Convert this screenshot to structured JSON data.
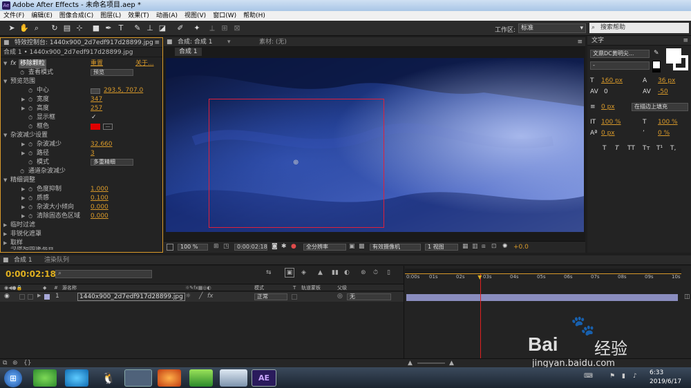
{
  "window": {
    "title": "Adobe After Effects - 未命名项目.aep *",
    "logo": "Ae"
  },
  "menu": [
    "文件(F)",
    "编辑(E)",
    "图像合成(C)",
    "图层(L)",
    "效果(T)",
    "动画(A)",
    "视图(V)",
    "窗口(W)",
    "帮助(H)"
  ],
  "toolbar": {
    "workspace_label": "工作区:",
    "workspace_value": "标准",
    "search_placeholder": "搜索帮助"
  },
  "effects_panel": {
    "tab": "特效控制台: 1440x900_2d7edf917d28899.jpg",
    "header": "合成 1 • 1440x900_2d7edf917d28899.jpg",
    "effect_name": "移除颗粒",
    "reset": "重置",
    "about": "关于...",
    "view_mode_label": "查看模式",
    "view_mode_value": "预览",
    "preview_region": "预览范围",
    "center_label": "中心",
    "center_value": "293.5, 707.0",
    "width_label": "宽度",
    "width_value": "347",
    "height_label": "高度",
    "height_value": "257",
    "show_box_label": "显示框",
    "show_box_check": "✓",
    "box_color_label": "框色",
    "noise_section": "杂波减少设置",
    "noise_reduction_label": "杂波减少",
    "noise_reduction_value": "32.660",
    "radius_label": "路径",
    "radius_value": "3",
    "mode_label": "模式",
    "mode_value": "多重精细",
    "channel_noise": "通道杂波减少",
    "fine_section": "精细调整",
    "chroma_label": "色度抑制",
    "chroma_value": "1.000",
    "texture_label": "质感",
    "texture_value": "0.100",
    "size_bias_label": "杂波大小倾向",
    "size_bias_value": "0.000",
    "clean_label": "清除固态色区域",
    "clean_value": "0.000",
    "temporal": "临时过滤",
    "unsharp": "非锐化遮罩",
    "sampling": "取样",
    "blend": "与原始图像混合"
  },
  "comp_panel": {
    "tab": "合成: 合成 1",
    "material": "素材: (无)",
    "subtab": "合成 1"
  },
  "viewer_bar": {
    "zoom": "100 %",
    "time": "0:00:02:18",
    "quality": "全分辨率",
    "camera": "有效摄像机",
    "views": "1 视图",
    "offset": "+0.0"
  },
  "text_panel": {
    "tab": "文字",
    "font": "文鼎DC黄明尖...",
    "style": "-",
    "size": "160 px",
    "leading": "36 px",
    "kerning": "0",
    "tracking": "-50",
    "stroke": "0 px",
    "stroke_mode": "在描边上填充",
    "vscale": "100 %",
    "hscale": "100 %",
    "baseline": "0 px",
    "tsume": "0 %",
    "styles": [
      "T",
      "T",
      "TT",
      "Tт",
      "T¹",
      "T,"
    ]
  },
  "timeline": {
    "tab_comp": "合成 1",
    "tab_render": "渲染队列",
    "time": "0:00:02:18",
    "col_source": "源名称",
    "col_mode": "模式",
    "col_t": "T",
    "col_trackmatte": "轨道蒙板",
    "col_parent": "父级",
    "layer_num": "1",
    "layer_name": "1440x900_2d7edf917d28899.jpg",
    "layer_mode": "正常",
    "layer_parent": "无",
    "ruler": [
      "0:00s",
      "01s",
      "02s",
      "03s",
      "04s",
      "05s",
      "06s",
      "07s",
      "08s",
      "09s",
      "10s"
    ],
    "playhead": 2.75,
    "duration": 10
  },
  "taskbar": {
    "time": "6:33",
    "date": "2019/6/17",
    "ae_label": "AE"
  },
  "watermark": {
    "brand": "Bai",
    "brand2": "经验",
    "url": "jingyan.baidu.com"
  },
  "colors": {
    "accent": "#d99a2a",
    "box": "#e0203a",
    "playhead": "#e02020",
    "timecode": "#e0b020"
  }
}
